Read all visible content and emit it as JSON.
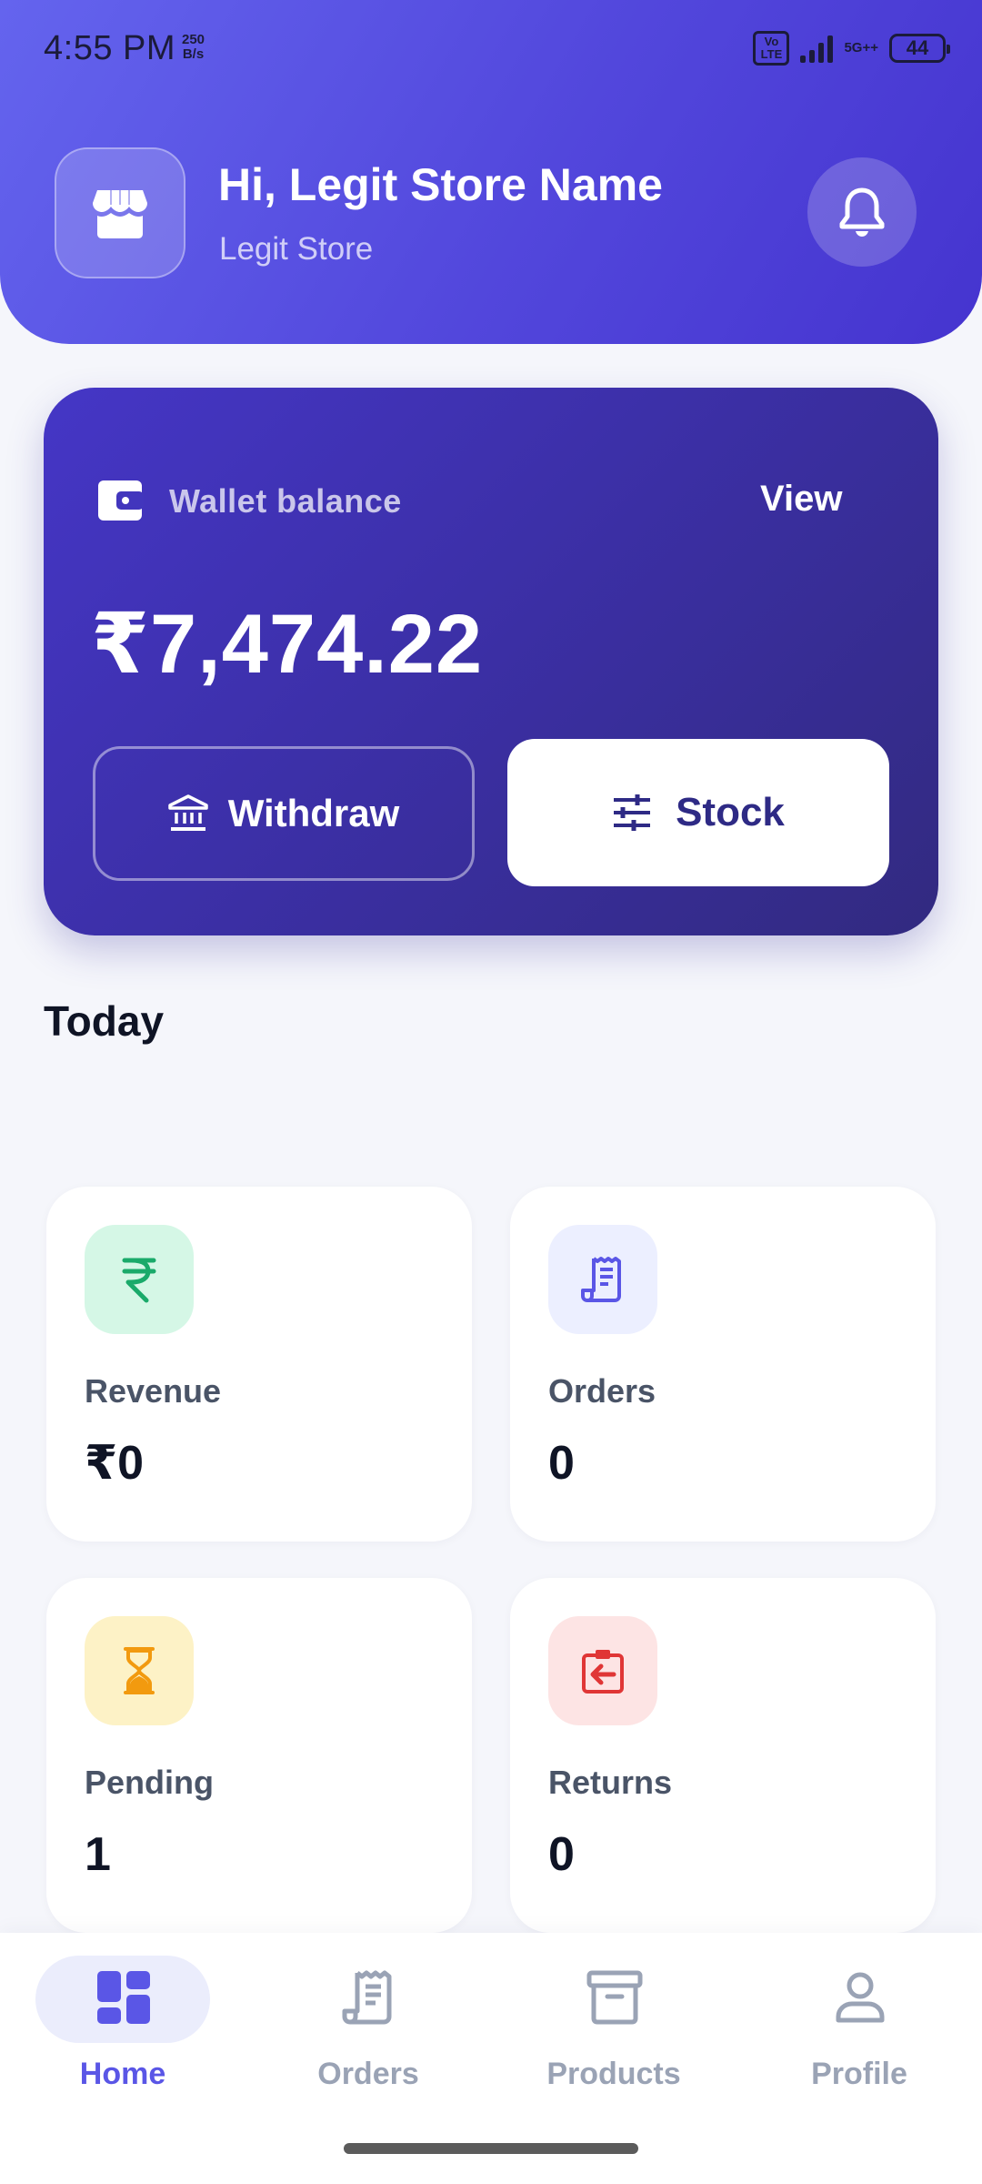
{
  "status_bar": {
    "time": "4:55 PM",
    "net_speed_value": "250",
    "net_speed_unit": "B/s",
    "volte_line1": "Vo",
    "volte_line2": "LTE",
    "network": "5G++",
    "battery": "44"
  },
  "header": {
    "greeting": "Hi, Legit Store Name",
    "store_name": "Legit Store"
  },
  "wallet": {
    "label": "Wallet balance",
    "view_label": "View",
    "amount": "₹7,474.22",
    "withdraw_label": "Withdraw",
    "stock_label": "Stock"
  },
  "today": {
    "title": "Today",
    "stats": [
      {
        "label": "Revenue",
        "value": "₹0",
        "icon": "rupee-icon",
        "icon_bg": "#d5f7e6",
        "icon_color": "#1aaa6a"
      },
      {
        "label": "Orders",
        "value": "0",
        "icon": "receipt-icon",
        "icon_bg": "#ecefff",
        "icon_color": "#5a56e6"
      },
      {
        "label": "Pending",
        "value": "1",
        "icon": "hourglass-icon",
        "icon_bg": "#fdf2c6",
        "icon_color": "#f29a0f"
      },
      {
        "label": "Returns",
        "value": "0",
        "icon": "return-icon",
        "icon_bg": "#fde4e4",
        "icon_color": "#e03636"
      }
    ]
  },
  "nav": {
    "items": [
      {
        "label": "Home",
        "icon": "dashboard-icon",
        "active": true
      },
      {
        "label": "Orders",
        "icon": "receipt-icon",
        "active": false
      },
      {
        "label": "Products",
        "icon": "archive-box-icon",
        "active": false
      },
      {
        "label": "Profile",
        "icon": "user-icon",
        "active": false
      }
    ],
    "active_color": "#5a56e6",
    "inactive_color": "#9aa3b5"
  },
  "colors": {
    "header_gradient_start": "#6464ee",
    "header_gradient_end": "#4534cf",
    "wallet_gradient_start": "#4536c6",
    "wallet_gradient_end": "#322a80",
    "background": "#f5f6fb"
  }
}
